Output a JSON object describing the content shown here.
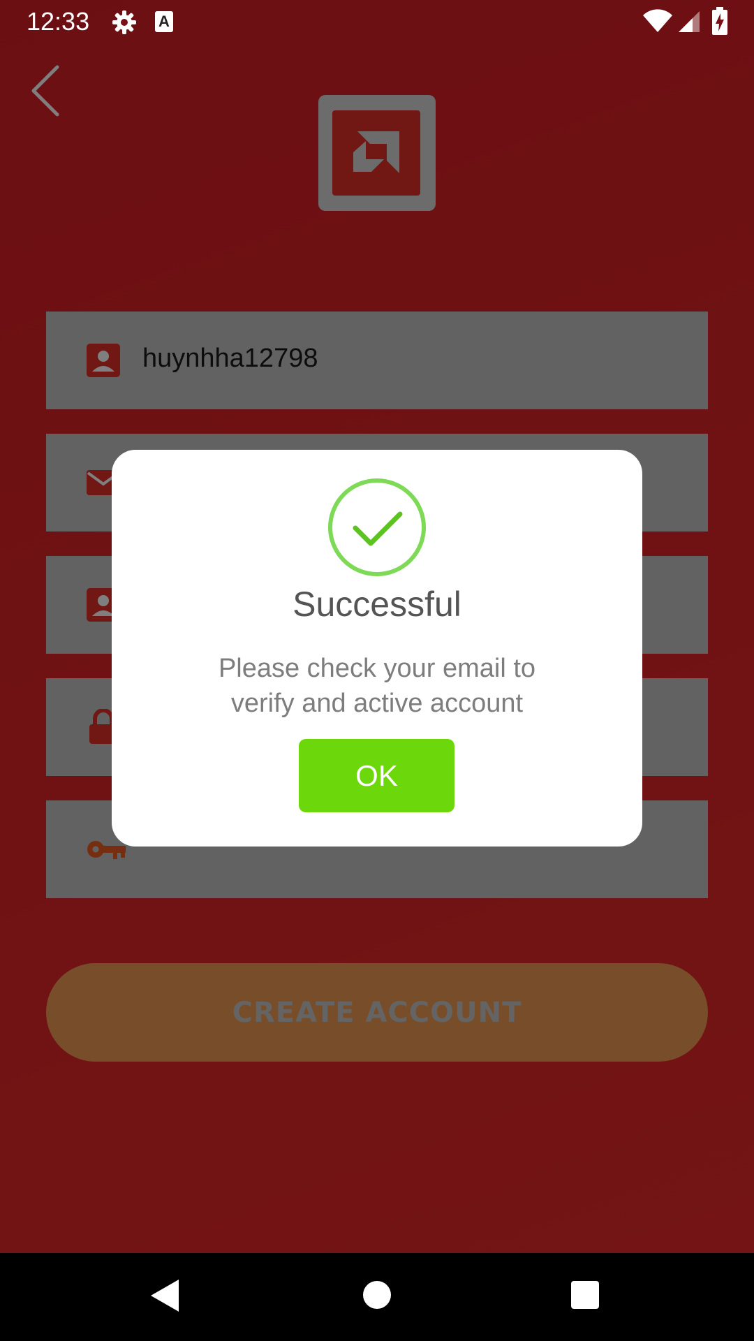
{
  "status_bar": {
    "time": "12:33",
    "icons": [
      "gear-icon",
      "a-notification-icon",
      "wifi-icon",
      "signal-icon",
      "battery-charging-icon"
    ],
    "a_icon_text": "A"
  },
  "form": {
    "username_value": "huynhha12798",
    "confirm_password_value": "•••••",
    "create_account_label": "CREATE ACCOUNT"
  },
  "dialog": {
    "title": "Successful",
    "message": "Please check your email to verify and active account",
    "ok_label": "OK"
  },
  "colors": {
    "background_red": "#e02527",
    "field_gray": "#c4c4c4",
    "button_orange": "#f19a55",
    "ok_green": "#6cd80b",
    "check_green": "#7ed957"
  }
}
